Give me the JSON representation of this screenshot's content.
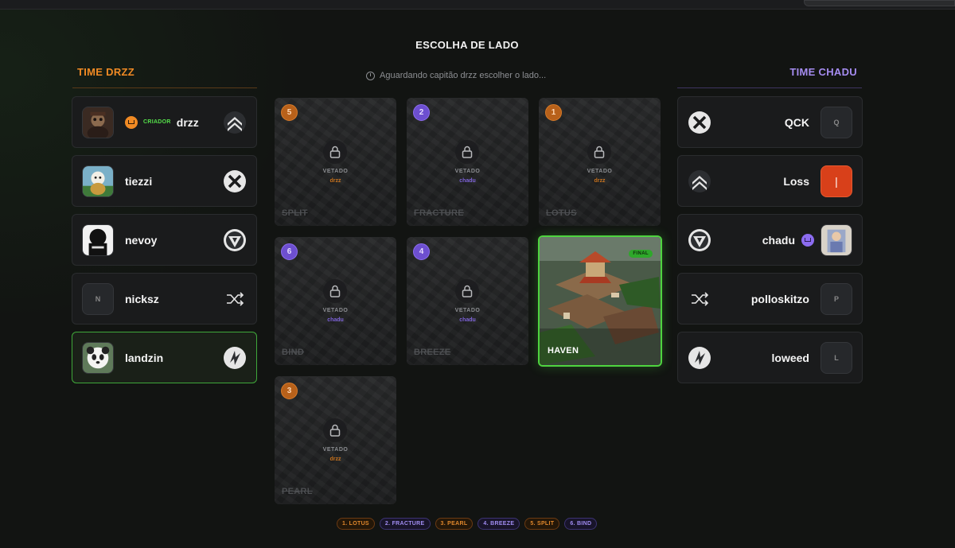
{
  "page": {
    "title": "ESCOLHA DE LADO",
    "status": "Aguardando capitão drzz escolher o lado..."
  },
  "teams": {
    "left": {
      "name": "TIME DRZZ",
      "color": "#f08a24",
      "players": [
        {
          "name": "drzz",
          "badge": "CRIADOR",
          "avatar": "photo",
          "agent_icon": "chevron-up-icon",
          "active": false
        },
        {
          "name": "tiezzi",
          "avatar": "photo",
          "agent_icon": "x-circle-icon",
          "active": false
        },
        {
          "name": "nevoy",
          "avatar": "photo",
          "agent_icon": "triangle-down-icon",
          "active": false
        },
        {
          "name": "nicksz",
          "avatar_initial": "N",
          "agent_icon": "shuffle-icon",
          "active": false
        },
        {
          "name": "landzin",
          "avatar": "photo",
          "agent_icon": "swirl-icon",
          "active": true
        }
      ]
    },
    "right": {
      "name": "TIME CHADU",
      "color": "#a58cf0",
      "players": [
        {
          "name": "QCK",
          "avatar_initial": "Q",
          "agent_icon": "x-circle-icon"
        },
        {
          "name": "Loss",
          "avatar_initial": "|",
          "agent_icon": "chevron-up-icon"
        },
        {
          "name": "chadu",
          "avatar": "photo",
          "agent_icon": "triangle-down-icon",
          "captain": true
        },
        {
          "name": "polloskitzo",
          "avatar_initial": "P",
          "agent_icon": "shuffle-icon"
        },
        {
          "name": "loweed",
          "avatar_initial": "L",
          "agent_icon": "swirl-icon"
        }
      ]
    }
  },
  "maps": [
    {
      "name": "SPLIT",
      "order": "5",
      "status": "VETADO",
      "by": "drzz",
      "team": "orange"
    },
    {
      "name": "FRACTURE",
      "order": "2",
      "status": "VETADO",
      "by": "chadu",
      "team": "purple"
    },
    {
      "name": "LOTUS",
      "order": "1",
      "status": "VETADO",
      "by": "drzz",
      "team": "orange"
    },
    {
      "name": "BIND",
      "order": "6",
      "status": "VETADO",
      "by": "chadu",
      "team": "purple"
    },
    {
      "name": "BREEZE",
      "order": "4",
      "status": "VETADO",
      "by": "chadu",
      "team": "purple"
    },
    {
      "name": "HAVEN",
      "badge": "FINAL"
    },
    {
      "name": "PEARL",
      "order": "3",
      "status": "VETADO",
      "by": "drzz",
      "team": "orange"
    }
  ],
  "veto_history": [
    {
      "label": "1. LOTUS",
      "team": "orange"
    },
    {
      "label": "2. FRACTURE",
      "team": "purple"
    },
    {
      "label": "3. PEARL",
      "team": "orange"
    },
    {
      "label": "4. BREEZE",
      "team": "purple"
    },
    {
      "label": "5. SPLIT",
      "team": "orange"
    },
    {
      "label": "6. BIND",
      "team": "purple"
    }
  ]
}
